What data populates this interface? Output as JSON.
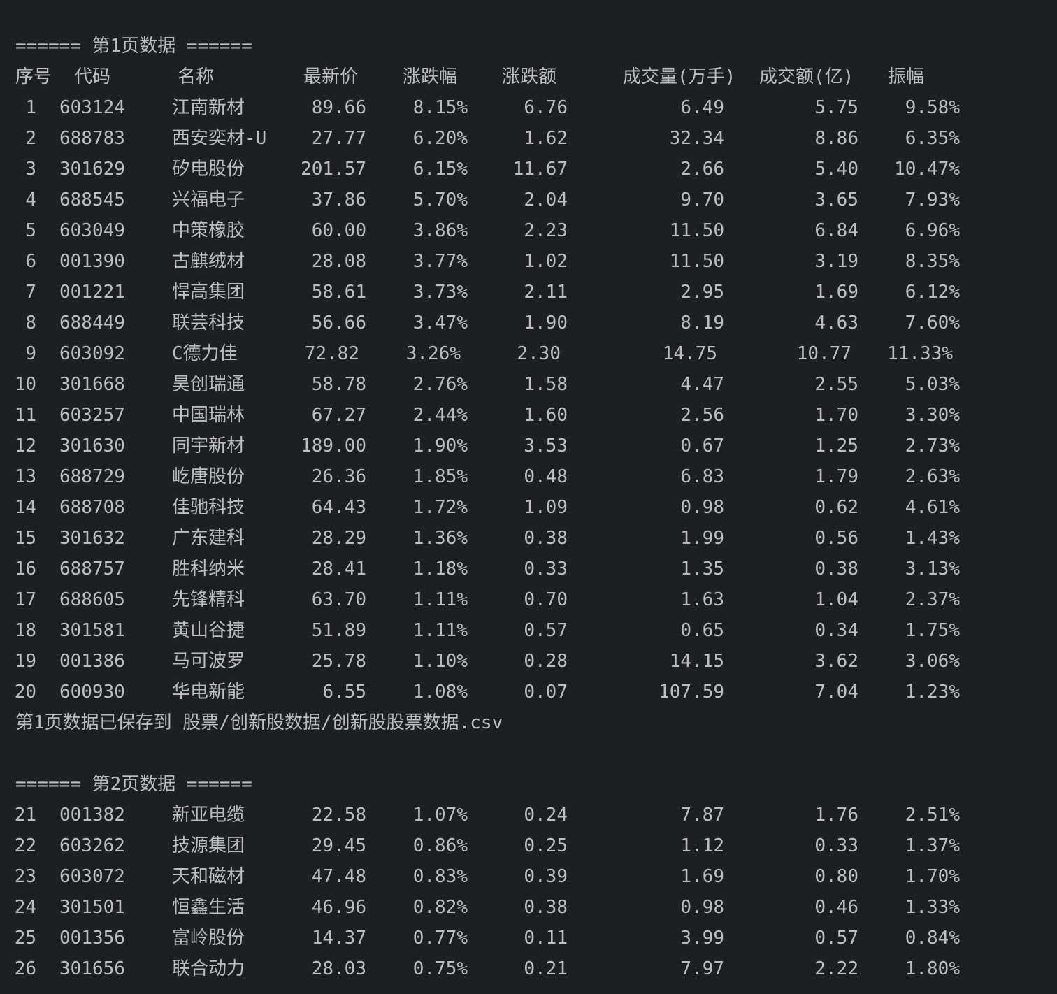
{
  "page1": {
    "header": "====== 第1页数据 ======",
    "saved": "第1页数据已保存到 股票/创新股数据/创新股股票数据.csv"
  },
  "page2": {
    "header": "====== 第2页数据 ======"
  },
  "columns": [
    "序号",
    "代码",
    "名称",
    "最新价",
    "涨跌幅",
    "涨跌额",
    "成交量(万手)",
    "成交额(亿)",
    "振幅"
  ],
  "rows": [
    [
      "1",
      "603124",
      "江南新材",
      "89.66",
      "8.15%",
      "6.76",
      "6.49",
      "5.75",
      "9.58%"
    ],
    [
      "2",
      "688783",
      "西安奕材-U",
      "27.77",
      "6.20%",
      "1.62",
      "32.34",
      "8.86",
      "6.35%"
    ],
    [
      "3",
      "301629",
      "矽电股份",
      "201.57",
      "6.15%",
      "11.67",
      "2.66",
      "5.40",
      "10.47%"
    ],
    [
      "4",
      "688545",
      "兴福电子",
      "37.86",
      "5.70%",
      "2.04",
      "9.70",
      "3.65",
      "7.93%"
    ],
    [
      "5",
      "603049",
      "中策橡胶",
      "60.00",
      "3.86%",
      "2.23",
      "11.50",
      "6.84",
      "6.96%"
    ],
    [
      "6",
      "001390",
      "古麒绒材",
      "28.08",
      "3.77%",
      "1.02",
      "11.50",
      "3.19",
      "8.35%"
    ],
    [
      "7",
      "001221",
      "悍高集团",
      "58.61",
      "3.73%",
      "2.11",
      "2.95",
      "1.69",
      "6.12%"
    ],
    [
      "8",
      "688449",
      "联芸科技",
      "56.66",
      "3.47%",
      "1.90",
      "8.19",
      "4.63",
      "7.60%"
    ],
    [
      "9",
      "603092",
      "C德力佳",
      "72.82",
      "3.26%",
      "2.30",
      "14.75",
      "10.77",
      "11.33%"
    ],
    [
      "10",
      "301668",
      "昊创瑞通",
      "58.78",
      "2.76%",
      "1.58",
      "4.47",
      "2.55",
      "5.03%"
    ],
    [
      "11",
      "603257",
      "中国瑞林",
      "67.27",
      "2.44%",
      "1.60",
      "2.56",
      "1.70",
      "3.30%"
    ],
    [
      "12",
      "301630",
      "同宇新材",
      "189.00",
      "1.90%",
      "3.53",
      "0.67",
      "1.25",
      "2.73%"
    ],
    [
      "13",
      "688729",
      "屹唐股份",
      "26.36",
      "1.85%",
      "0.48",
      "6.83",
      "1.79",
      "2.63%"
    ],
    [
      "14",
      "688708",
      "佳驰科技",
      "64.43",
      "1.72%",
      "1.09",
      "0.98",
      "0.62",
      "4.61%"
    ],
    [
      "15",
      "301632",
      "广东建科",
      "28.29",
      "1.36%",
      "0.38",
      "1.99",
      "0.56",
      "1.43%"
    ],
    [
      "16",
      "688757",
      "胜科纳米",
      "28.41",
      "1.18%",
      "0.33",
      "1.35",
      "0.38",
      "3.13%"
    ],
    [
      "17",
      "688605",
      "先锋精科",
      "63.70",
      "1.11%",
      "0.70",
      "1.63",
      "1.04",
      "2.37%"
    ],
    [
      "18",
      "301581",
      "黄山谷捷",
      "51.89",
      "1.11%",
      "0.57",
      "0.65",
      "0.34",
      "1.75%"
    ],
    [
      "19",
      "001386",
      "马可波罗",
      "25.78",
      "1.10%",
      "0.28",
      "14.15",
      "3.62",
      "3.06%"
    ],
    [
      "20",
      "600930",
      "华电新能",
      "6.55",
      "1.08%",
      "0.07",
      "107.59",
      "7.04",
      "1.23%"
    ],
    [
      "21",
      "001382",
      "新亚电缆",
      "22.58",
      "1.07%",
      "0.24",
      "7.87",
      "1.76",
      "2.51%"
    ],
    [
      "22",
      "603262",
      "技源集团",
      "29.45",
      "0.86%",
      "0.25",
      "1.12",
      "0.33",
      "1.37%"
    ],
    [
      "23",
      "603072",
      "天和磁材",
      "47.48",
      "0.83%",
      "0.39",
      "1.69",
      "0.80",
      "1.70%"
    ],
    [
      "24",
      "301501",
      "恒鑫生活",
      "46.96",
      "0.82%",
      "0.38",
      "0.98",
      "0.46",
      "1.33%"
    ],
    [
      "25",
      "001356",
      "富岭股份",
      "14.37",
      "0.77%",
      "0.11",
      "3.99",
      "0.57",
      "0.84%"
    ],
    [
      "26",
      "301656",
      "联合动力",
      "28.03",
      "0.75%",
      "0.21",
      "7.97",
      "2.22",
      "1.80%"
    ]
  ]
}
